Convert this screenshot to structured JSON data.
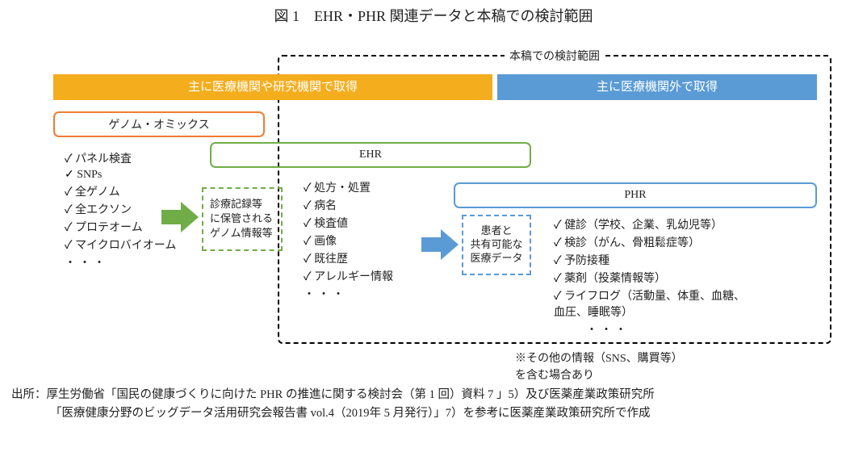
{
  "title": "図 1　EHR・PHR 関連データと本稿での検討範囲",
  "scope_label": "本稿での検討範囲",
  "bars": {
    "orange": "主に医療機関や研究機関で取得",
    "blue": "主に医療機関外で取得"
  },
  "genomics": {
    "label": "ゲノム・オミックス",
    "items": [
      "パネル検査",
      "SNPs",
      "全ゲノム",
      "全エクソン",
      "プロテオーム",
      "マイクロバイオーム"
    ]
  },
  "note_green": "診療記録等\nに保管される\nゲノム情報等",
  "ehr": {
    "label": "EHR",
    "items": [
      "処方・処置",
      "病名",
      "検査値",
      "画像",
      "既往歴",
      "アレルギー情報"
    ]
  },
  "note_blue": "患者と\n共有可能な\n医療データ",
  "phr": {
    "label": "PHR",
    "items": [
      "健診（学校、企業、乳幼児等）",
      "検診（がん、骨粗鬆症等）",
      "予防接種",
      "薬剤（投薬情報等）",
      "ライフログ（活動量、体重、血糖、\n血圧、睡眠等）"
    ]
  },
  "footnote": "※その他の情報（SNS、購買等）\nを含む場合あり",
  "source_line1": "出所：厚生労働省「国民の健康づくりに向けた PHR の推進に関する検討会（第 1 回）資料 7 」5）及び医薬産業政策研究所",
  "source_line2": "「医療健康分野のビッグデータ活用研究会報告書 vol.4（2019年 5 月発行）」7）を参考に医薬産業政策研究所で作成"
}
